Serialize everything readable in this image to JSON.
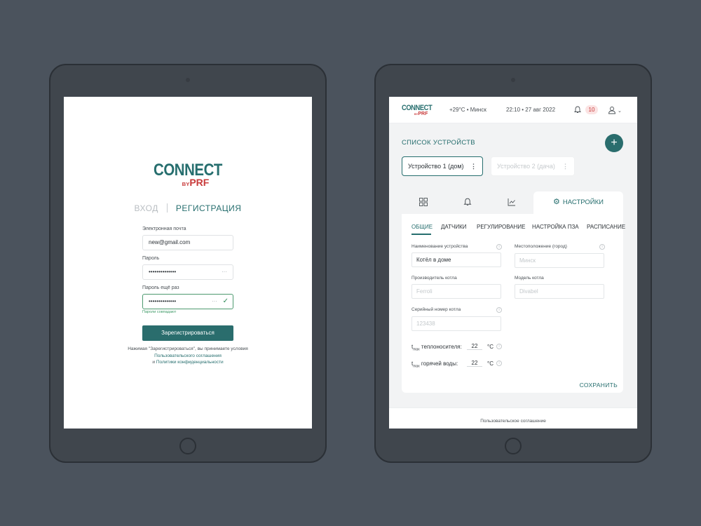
{
  "login": {
    "logo": {
      "word": "CONNECT",
      "by": "BY",
      "brand": "PRF"
    },
    "tab_login": "ВХОД",
    "tab_register": "РЕГИСТРАЦИЯ",
    "email_label": "Электронная почта",
    "email_value": "new@gmail.com",
    "password_label": "Пароль",
    "password_value": "••••••••••••••",
    "password_repeat_label": "Пароль ещё раз",
    "password_repeat_value": "••••••••••••••",
    "password_hint": "Пароли совпадают",
    "register_button": "Зарегистрироваться",
    "terms_prefix": "Нажимая \"Зарегистрироваться\", вы принимаете условия",
    "terms_link": "Пользовательского соглашения",
    "terms_and": "и",
    "privacy_link": "Политики конфиденциальности"
  },
  "app": {
    "logo": {
      "word": "CONNECT",
      "by": "BY",
      "brand": "PRF"
    },
    "weather": "+29°C • Минск",
    "datetime": "22:10 • 27 авг 2022",
    "notifications_count": "10",
    "devices_title": "СПИСОК УСТРОЙСТВ",
    "add_label": "+",
    "devices": [
      "Устройство 1 (дом)",
      "Устройство 2 (дача)"
    ],
    "settings_tab": "НАСТРОЙКИ",
    "subtabs": [
      "ОБЩИЕ",
      "ДАТЧИКИ",
      "РЕГУЛИРОВАНИЕ",
      "НАСТРОЙКА ПЗА",
      "РАСПИСАНИЕ"
    ],
    "fields": {
      "device_name_label": "Наименование устройства",
      "device_name_value": "Котёл в доме",
      "location_label": "Местоположение (город)",
      "location_placeholder": "Минск",
      "manufacturer_label": "Производитель котла",
      "manufacturer_placeholder": "Ferroli",
      "model_label": "Модель котла",
      "model_placeholder": "Divabel",
      "serial_label": "Серийный номер котла",
      "serial_placeholder": "123438"
    },
    "tmax_coolant_label": "теплоносителя:",
    "tmax_coolant_value": "22",
    "tmax_water_label": "горячей воды:",
    "tmax_water_value": "22",
    "t_symbol": "t",
    "max_sub": "max",
    "unit": "°C",
    "save_button": "СОХРАНИТЬ",
    "footer_link": "Пользовательское соглашение"
  },
  "colors": {
    "accent": "#266e6e",
    "brand_red": "#c83a3a",
    "background": "#4b535d"
  }
}
